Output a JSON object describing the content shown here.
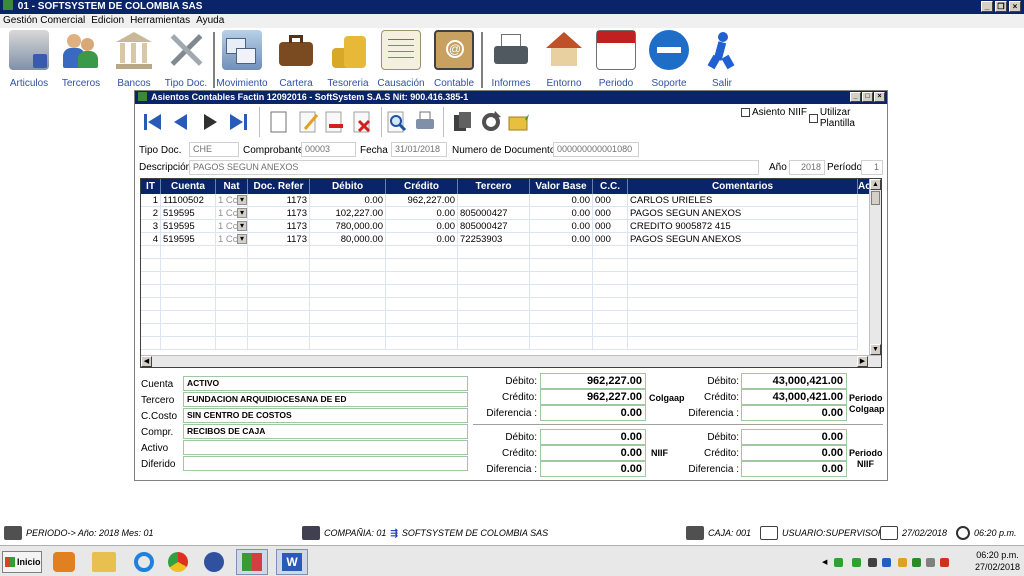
{
  "app": {
    "title": "01 - SOFTSYSTEM DE COLOMBIA SAS"
  },
  "menu": [
    "Gestión Comercial",
    "Edicion",
    "Herramientas",
    "Ayuda"
  ],
  "toolbar": [
    {
      "label": "Articulos",
      "icon": "articles-icon"
    },
    {
      "label": "Terceros",
      "icon": "people-icon"
    },
    {
      "label": "Bancos",
      "icon": "bank-icon"
    },
    {
      "label": "Tipo Doc.",
      "icon": "tools-icon"
    },
    {
      "label": "Movimiento",
      "icon": "windows-icon"
    },
    {
      "label": "Cartera",
      "icon": "briefcase-icon"
    },
    {
      "label": "Tesoreria",
      "icon": "coins-icon"
    },
    {
      "label": "Causación",
      "icon": "notebook-icon"
    },
    {
      "label": "Contable",
      "icon": "address-book-icon"
    },
    {
      "label": "Informes",
      "icon": "printer-icon"
    },
    {
      "label": "Entorno",
      "icon": "house-icon"
    },
    {
      "label": "Periodo",
      "icon": "calendar-icon"
    },
    {
      "label": "Soporte",
      "icon": "teamviewer-icon"
    },
    {
      "label": "Salir",
      "icon": "exit-runner-icon"
    }
  ],
  "child": {
    "title": "Asientos Contables Factin 12092016 - SoftSystem S.A.S Nit: 900.416.385-1",
    "check_niif": "Asiento NIIF",
    "check_plantilla": "Utilizar Plantilla"
  },
  "form": {
    "tipo_doc_label": "Tipo Doc.",
    "tipo_doc": "CHE",
    "comprobante_label": "Comprobante",
    "comprobante": "00003",
    "fecha_label": "Fecha",
    "fecha": "31/01/2018",
    "numdoc_label": "Numero de Documento",
    "numdoc": "000000000001080",
    "descripcion_label": "Descripción",
    "descripcion": "PAGOS SEGUN ANEXOS",
    "anio_label": "Año",
    "anio": "2018",
    "periodo_label": "Período",
    "periodo": "1"
  },
  "grid": {
    "headers": [
      "IT",
      "Cuenta",
      "Nat",
      "Doc. Refer",
      "Débito",
      "Crédito",
      "Tercero",
      "Valor Base",
      "C.C.",
      "Comentarios",
      "Ac"
    ],
    "rows": [
      {
        "it": "1",
        "cuenta": "11100502",
        "nat": "1 Cc",
        "doc": "1173",
        "debito": "0.00",
        "credito": "962,227.00",
        "tercero": "",
        "base": "0.00",
        "cc": "000",
        "comentario": "CARLOS URIELES"
      },
      {
        "it": "2",
        "cuenta": "519595",
        "nat": "1 Cc",
        "doc": "1173",
        "debito": "102,227.00",
        "credito": "0.00",
        "tercero": "805000427",
        "base": "0.00",
        "cc": "000",
        "comentario": "PAGOS SEGUN ANEXOS"
      },
      {
        "it": "3",
        "cuenta": "519595",
        "nat": "1 Cc",
        "doc": "1173",
        "debito": "780,000.00",
        "credito": "0.00",
        "tercero": "805000427",
        "base": "0.00",
        "cc": "000",
        "comentario": "CREDITO 9005872 415"
      },
      {
        "it": "4",
        "cuenta": "519595",
        "nat": "1 Cc",
        "doc": "1173",
        "debito": "80,000.00",
        "credito": "0.00",
        "tercero": "72253903",
        "base": "0.00",
        "cc": "000",
        "comentario": "PAGOS SEGUN ANEXOS"
      }
    ]
  },
  "details": {
    "cuenta_label": "Cuenta",
    "cuenta": "ACTIVO",
    "tercero_label": "Tercero",
    "tercero": "FUNDACION ARQUIDIOCESANA DE ED",
    "ccosto_label": "C.Costo",
    "ccosto": "SIN CENTRO DE COSTOS",
    "compr_label": "Compr.",
    "compr": "RECIBOS DE CAJA",
    "activo_label": "Activo",
    "activo": "",
    "diferido_label": "Diferido",
    "diferido": ""
  },
  "totals": {
    "debito_label": "Débito:",
    "credito_label": "Crédito:",
    "diferencia_label": "Diferencia :",
    "colgaap_doc": {
      "debito": "962,227.00",
      "credito": "962,227.00",
      "diferencia": "0.00"
    },
    "colgaap_periodo": {
      "debito": "43,000,421.00",
      "credito": "43,000,421.00",
      "diferencia": "0.00"
    },
    "niif_doc": {
      "debito": "0.00",
      "credito": "0.00",
      "diferencia": "0.00"
    },
    "niif_periodo": {
      "debito": "0.00",
      "credito": "0.00",
      "diferencia": "0.00"
    },
    "colgaap_label": "Colgaap",
    "niif_label": "NIIF",
    "periodo_colgaap": [
      "Periodo",
      "Colgaap"
    ],
    "periodo_niif": [
      "Periodo",
      "NIIF"
    ]
  },
  "status": {
    "periodo": "PERIODO-> Año: 2018  Mes: 01",
    "compania": "COMPAÑIA: 01",
    "empresa": "SOFTSYSTEM DE COLOMBIA SAS",
    "caja": "CAJA: 001",
    "usuario": "USUARIO:SUPERVISOR",
    "fecha": "27/02/2018",
    "hora": "06:20 p.m."
  },
  "taskbar": {
    "start": "Inicio",
    "clock_time": "06:20 p.m.",
    "clock_date": "27/02/2018",
    "apps": [
      "media-player-icon",
      "file-explorer-icon",
      "internet-explorer-icon",
      "chrome-icon",
      "app-grid-icon",
      "softsystem-icon",
      "word-icon"
    ]
  },
  "colors": {
    "titlebar": "#0a246a",
    "grid_header": "#0a246a",
    "link_blue": "#3050a0"
  }
}
